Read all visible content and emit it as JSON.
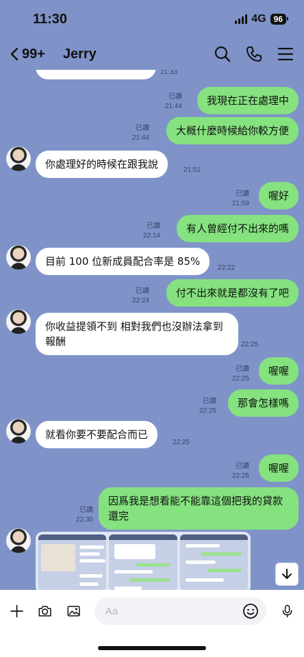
{
  "status": {
    "time": "11:30",
    "network": "4G",
    "battery": "96"
  },
  "header": {
    "unread_count": "99+",
    "contact_name": "Jerry"
  },
  "read_label": "已讀",
  "messages": [
    {
      "id": "m0",
      "text": "",
      "time": "21:33",
      "dir": "in"
    },
    {
      "id": "m1",
      "text": "我現在正在處理中",
      "time": "21:44",
      "dir": "out"
    },
    {
      "id": "m2",
      "text": "大概什麼時候給你較方便",
      "time": "21:44",
      "dir": "out"
    },
    {
      "id": "m3",
      "text": "你處理好的時候在跟我說",
      "time": "21:51",
      "dir": "in"
    },
    {
      "id": "m4",
      "text": "喔好",
      "time": "21:59",
      "dir": "out"
    },
    {
      "id": "m5",
      "text": "有人曾經付不出來的嗎",
      "time": "22:14",
      "dir": "out"
    },
    {
      "id": "m6",
      "text": "目前 100 位新成員配合率是 85%",
      "time": "22:22",
      "dir": "in"
    },
    {
      "id": "m7",
      "text": "付不出來就是都沒有了吧",
      "time": "22:24",
      "dir": "out"
    },
    {
      "id": "m8",
      "text": "你收益提領不到 相對我們也沒辦法拿到報酬",
      "time": "22:25",
      "dir": "in"
    },
    {
      "id": "m9",
      "text": "喔喔",
      "time": "22:25",
      "dir": "out"
    },
    {
      "id": "m10",
      "text": "那會怎樣嗎",
      "time": "22:25",
      "dir": "out"
    },
    {
      "id": "m11",
      "text": "就看你要不要配合而已",
      "time": "22:25",
      "dir": "in"
    },
    {
      "id": "m12",
      "text": "喔喔",
      "time": "22:25",
      "dir": "out"
    },
    {
      "id": "m13",
      "text": "因爲我是想看能不能靠這個把我的貸款還完",
      "time": "22:30",
      "dir": "out"
    }
  ],
  "input": {
    "placeholder": "Aa",
    "value": ""
  },
  "icons": {
    "back": "chevron-left-icon",
    "search": "search-icon",
    "call": "phone-icon",
    "menu": "menu-icon",
    "add": "plus-icon",
    "camera": "camera-icon",
    "image": "image-icon",
    "emoji": "emoji-icon",
    "mic": "microphone-icon",
    "scroll": "arrow-down-icon"
  },
  "colors": {
    "background": "#7f93c9",
    "outgoing_bubble": "#85e27f",
    "incoming_bubble": "#ffffff"
  }
}
